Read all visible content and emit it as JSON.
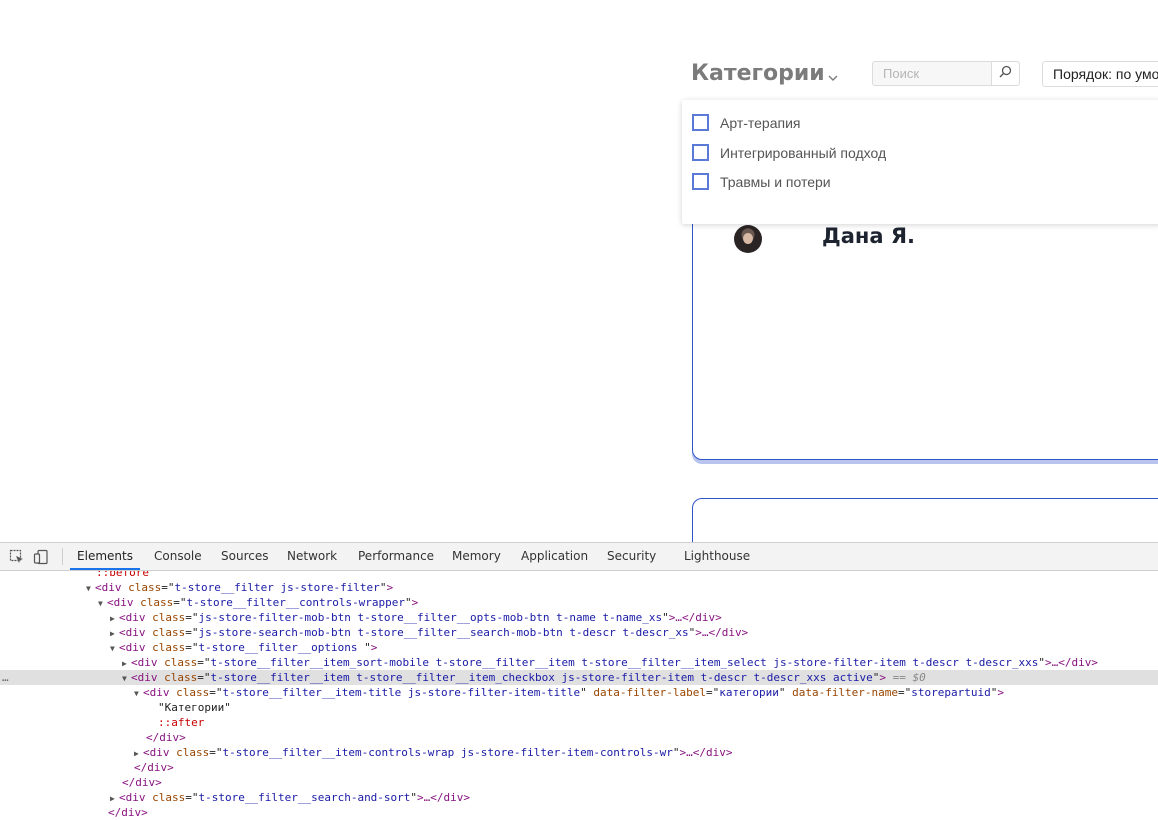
{
  "page": {
    "filter_title": "Категории",
    "search_placeholder": "Поиск",
    "sort_label": "Порядок: по умолчанию",
    "categories": [
      {
        "label": "Арт-терапия"
      },
      {
        "label": "Интегрированный подход"
      },
      {
        "label": "Травмы и потери"
      }
    ],
    "card": {
      "name": "Дана Я."
    }
  },
  "devtools": {
    "tabs": [
      "Elements",
      "Console",
      "Sources",
      "Network",
      "Performance",
      "Memory",
      "Application",
      "Security",
      "Lighthouse"
    ],
    "active_tab": "Elements",
    "pseudo_before": "::before",
    "lines": [
      {
        "tri": "▼",
        "tag": "div",
        "attrs": [
          [
            "class",
            "t-store__filter js-store-filter"
          ]
        ],
        "close": ">",
        "tail": ""
      },
      {
        "tri": "▼",
        "tag": "div",
        "attrs": [
          [
            "class",
            "t-store__filter__controls-wrapper"
          ]
        ],
        "close": ">",
        "tail": ""
      },
      {
        "tri": "▶",
        "tag": "div",
        "attrs": [
          [
            "class",
            "js-store-filter-mob-btn t-store__filter__opts-mob-btn t-name t-name_xs"
          ]
        ],
        "close": ">…</div>",
        "tail": ""
      },
      {
        "tri": "▶",
        "tag": "div",
        "attrs": [
          [
            "class",
            "js-store-search-mob-btn t-store__filter__search-mob-btn t-descr t-descr_xs"
          ]
        ],
        "close": ">…</div>",
        "tail": ""
      },
      {
        "tri": "▼",
        "tag": "div",
        "attrs": [
          [
            "class",
            "t-store__filter__options "
          ]
        ],
        "close": ">",
        "tail": ""
      },
      {
        "tri": "▶",
        "tag": "div",
        "attrs": [
          [
            "class",
            "t-store__filter__item_sort-mobile t-store__filter__item t-store__filter__item_select js-store-filter-item t-descr t-descr_xxs"
          ]
        ],
        "close": ">…</div>",
        "tail": ""
      },
      {
        "tri": "▼",
        "tag": "div",
        "attrs": [
          [
            "class",
            "t-store__filter__item t-store__filter__item_checkbox js-store-filter-item t-descr t-descr_xxs active"
          ]
        ],
        "close": ">",
        "tail": " == $0"
      },
      {
        "tri": "▼",
        "tag": "div",
        "attrs": [
          [
            "class",
            "t-store__filter__item-title js-store-filter-item-title"
          ],
          [
            "data-filter-label",
            "категории"
          ],
          [
            "data-filter-name",
            "storepartuid"
          ]
        ],
        "close": ">",
        "tail": ""
      },
      {
        "text": "\"Категории\""
      },
      {
        "pseudo": "::after"
      },
      {
        "closetag": "</div>"
      },
      {
        "tri": "▶",
        "tag": "div",
        "attrs": [
          [
            "class",
            "t-store__filter__item-controls-wrap js-store-filter-item-controls-wr"
          ]
        ],
        "close": ">…</div>",
        "tail": ""
      },
      {
        "closetag": "</div>"
      },
      {
        "closetag": "</div>"
      },
      {
        "tri": "▶",
        "tag": "div",
        "attrs": [
          [
            "class",
            "t-store__filter__search-and-sort"
          ]
        ],
        "close": ">…</div>",
        "tail": ""
      },
      {
        "closetag": "</div>"
      }
    ]
  },
  "colors": {
    "accent": "#2f54c8",
    "checkbox": "#5b79d6",
    "devtools_active": "#1a73e8"
  }
}
